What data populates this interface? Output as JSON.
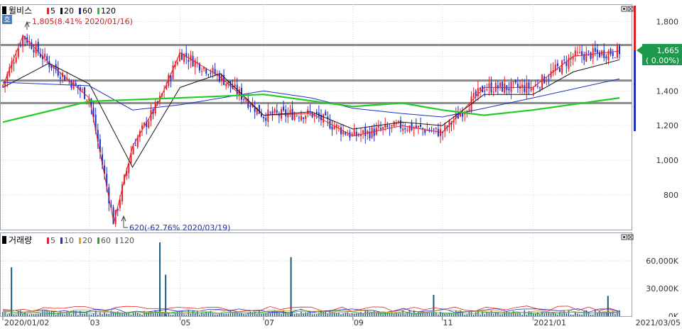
{
  "price_panel": {
    "name": "윌비스",
    "ma_labels": [
      "5",
      "20",
      "60",
      "120"
    ],
    "ma_colors": [
      "#e8202a",
      "#111111",
      "#1c2fc8",
      "#22cc22"
    ],
    "badge": "호",
    "high_note": "1,805(8.41% 2020/01/16)",
    "low_note": "620(-62.76% 2020/03/19)",
    "y_ticks": [
      "1,800",
      "1,600",
      "1,400",
      "1,200",
      "1,000",
      "800"
    ],
    "current_price": "1,665",
    "current_change": "( 0.00%)",
    "up_color": "#e8202a",
    "down_color": "#1c2fc8"
  },
  "volume_panel": {
    "name": "거래량",
    "ma_labels": [
      "5",
      "10",
      "20",
      "60",
      "120"
    ],
    "ma_colors": [
      "#e8202a",
      "#1c2fc8",
      "#e8a020",
      "#22aa22",
      "#999999"
    ],
    "y_ticks": [
      "60,000K",
      "30,000K",
      "0K"
    ]
  },
  "x_axis": {
    "labels": [
      "2020/01/02",
      "03",
      "05",
      "07",
      "09",
      "11",
      "2021/01",
      "2021/03/05"
    ]
  },
  "chart_data": [
    {
      "type": "line",
      "title": "윌비스",
      "ylim": [
        600,
        1900
      ],
      "y_ticks": [
        1800,
        1600,
        1400,
        1200,
        1000,
        800
      ],
      "x_start": "2020/01/02",
      "x_end": "2021/03/05",
      "series": [
        {
          "name": "5",
          "x": [
            "2020/01/02",
            "2020/01/16",
            "2020/02/03",
            "2020/03/02",
            "2020/03/19",
            "2020/04/01",
            "2020/04/20",
            "2020/05/04",
            "2020/06/01",
            "2020/07/01",
            "2020/08/03",
            "2020/09/01",
            "2020/10/05",
            "2020/11/02",
            "2020/12/01",
            "2021/01/04",
            "2021/02/01",
            "2021/03/05"
          ],
          "values": [
            1430,
            1720,
            1560,
            1360,
            640,
            1080,
            1350,
            1620,
            1480,
            1260,
            1270,
            1140,
            1200,
            1160,
            1420,
            1420,
            1600,
            1630
          ]
        },
        {
          "name": "20",
          "x": [
            "2020/01/02",
            "2020/02/03",
            "2020/03/02",
            "2020/04/01",
            "2020/05/04",
            "2020/06/01",
            "2020/07/01",
            "2020/08/03",
            "2020/09/01",
            "2020/10/05",
            "2020/11/02",
            "2020/12/01",
            "2021/01/04",
            "2021/02/01",
            "2021/03/05"
          ],
          "values": [
            1420,
            1560,
            1440,
            960,
            1420,
            1500,
            1260,
            1280,
            1180,
            1220,
            1200,
            1380,
            1380,
            1510,
            1580
          ]
        },
        {
          "name": "60",
          "x": [
            "2020/01/02",
            "2020/03/02",
            "2020/04/01",
            "2020/05/04",
            "2020/07/01",
            "2020/08/03",
            "2020/09/01",
            "2020/10/05",
            "2020/11/02",
            "2020/12/01",
            "2021/01/04",
            "2021/03/05"
          ],
          "values": [
            1450,
            1430,
            1290,
            1320,
            1400,
            1360,
            1300,
            1270,
            1250,
            1300,
            1360,
            1470
          ]
        },
        {
          "name": "120",
          "x": [
            "2020/01/02",
            "2020/03/02",
            "2020/05/04",
            "2020/07/01",
            "2020/09/01",
            "2020/10/05",
            "2020/11/02",
            "2020/12/01",
            "2021/01/04",
            "2021/03/05"
          ],
          "values": [
            1220,
            1340,
            1360,
            1380,
            1310,
            1330,
            1290,
            1260,
            1290,
            1360
          ]
        }
      ],
      "horizontal_lines": [
        1665,
        1460,
        1330
      ],
      "annotations": [
        {
          "text": "1,805(8.41% 2020/01/16)",
          "x": "2020/01/16",
          "y": 1805
        },
        {
          "text": "620(-62.76% 2020/03/19)",
          "x": "2020/03/19",
          "y": 620
        }
      ],
      "grid": true
    },
    {
      "type": "bar",
      "title": "거래량",
      "ylim": [
        0,
        90000
      ],
      "y_ticks": [
        60000,
        30000,
        0
      ],
      "spikes": [
        {
          "x": "2020/01/08",
          "value": 53000
        },
        {
          "x": "2020/04/20",
          "value": 80000
        },
        {
          "x": "2020/04/24",
          "value": 45000
        },
        {
          "x": "2020/07/20",
          "value": 64000
        },
        {
          "x": "2020/10/27",
          "value": 23000
        },
        {
          "x": "2021/02/25",
          "value": 22000
        }
      ],
      "grid": true
    }
  ]
}
